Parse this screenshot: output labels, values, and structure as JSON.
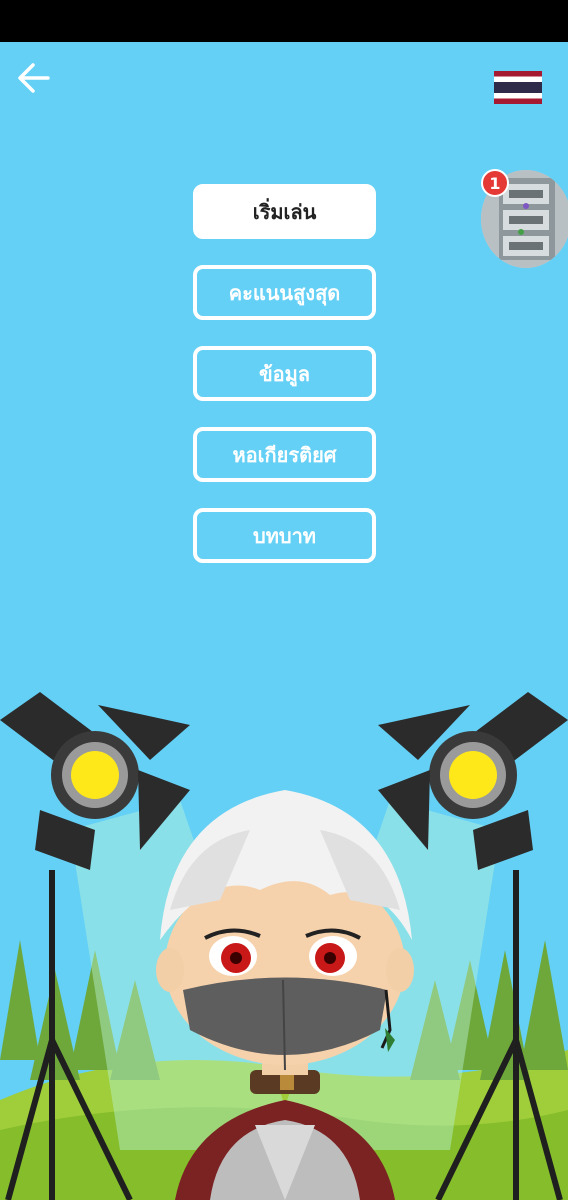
{
  "menu": {
    "items": [
      {
        "label": "เริ่มเล่น"
      },
      {
        "label": "คะแนนสูงสุด"
      },
      {
        "label": "ข้อมูล"
      },
      {
        "label": "หอเกียรติยศ"
      },
      {
        "label": "บทบาท"
      }
    ]
  },
  "notification": {
    "count": "1"
  },
  "icons": {
    "back": "arrow-left-icon",
    "language": "thailand-flag-icon"
  },
  "colors": {
    "background": "#64d0f6",
    "button_border": "#ffffff",
    "badge": "#e53935"
  }
}
